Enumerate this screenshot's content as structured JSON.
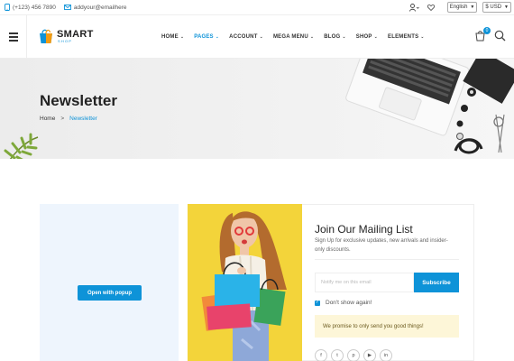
{
  "topbar": {
    "phone": "(+123) 456 7890",
    "email": "addyour@emailhere",
    "language": "English",
    "currency": "$ USD"
  },
  "logo": {
    "main": "SMART",
    "sub": "SHOP"
  },
  "nav": {
    "items": [
      {
        "label": "HOME"
      },
      {
        "label": "PAGES",
        "active": true
      },
      {
        "label": "ACCOUNT"
      },
      {
        "label": "MEGA MENU"
      },
      {
        "label": "BLOG"
      },
      {
        "label": "SHOP"
      },
      {
        "label": "ELEMENTS"
      }
    ]
  },
  "cart": {
    "count": "0"
  },
  "banner": {
    "title": "Newsletter",
    "breadcrumb": {
      "home": "Home",
      "separator": ">",
      "current": "Newsletter"
    }
  },
  "popup": {
    "button": "Open with popup"
  },
  "newsletter": {
    "title": "Join Our Mailing List",
    "description": "Sign Up for exclusive updates, new arrivals and insider-only discounts.",
    "email_placeholder": "Notify me on this email",
    "subscribe": "Subscribe",
    "dont_show": "Don't show again!",
    "notice": "We promise to only send you good things!",
    "socials": [
      {
        "icon": "facebook-icon",
        "glyph": "f"
      },
      {
        "icon": "twitter-icon",
        "glyph": "t"
      },
      {
        "icon": "pinterest-icon",
        "glyph": "p"
      },
      {
        "icon": "youtube-icon",
        "glyph": "▶"
      },
      {
        "icon": "linkedin-icon",
        "glyph": "in"
      }
    ]
  },
  "colors": {
    "accent": "#0e93d8",
    "popup_bg": "#eef5fd",
    "photo_bg": "#f3d43a",
    "notice_bg": "#fdf6d8"
  }
}
